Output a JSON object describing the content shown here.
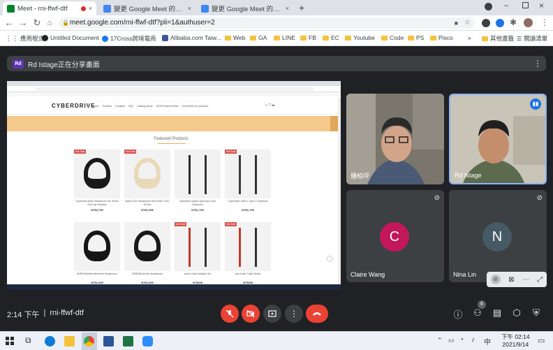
{
  "browser": {
    "tabs": [
      {
        "label": "Meet - rni-ffwf-dtf",
        "close": "×"
      },
      {
        "label": "變更 Google Meet 的背景並使用",
        "close": "×"
      },
      {
        "label": "變更 Google Meet 的背景並使用",
        "close": "×"
      }
    ],
    "new_tab": "+",
    "url": "meet.google.com/rni-ffwf-dtf?pli=1&authuser=2",
    "bookmarks": [
      "應用程式",
      "Untitled Document",
      "17Cross跨境電商",
      "Alibaba.com Taiw...",
      "Web",
      "GA",
      "LINE",
      "FB",
      "EC",
      "Youtube",
      "Code",
      "PS",
      "Pisco",
      "»",
      "其他書籤",
      "閱讀清單"
    ]
  },
  "meet": {
    "presenter_banner": "Rd Istage正在分享畫面",
    "presenter_initials": "Rd",
    "shared_site": {
      "brand": "CYBERDRIVE",
      "nav": [
        "Home",
        "Products",
        "Contacts",
        "FAQ",
        "Catalog ebook",
        "OEM Product Series",
        "Good Word for products"
      ],
      "section_title": "Featured Products",
      "products": [
        {
          "name": "Cyberdrive Bass Headphone M1 Series Ear-Cup Headset",
          "price": "NT$2,799",
          "badge": "Hot Sale"
        },
        {
          "name": "Super DSX Headphone with USB-C DAC Hi-Res",
          "price": "NT$2,999",
          "badge": "Hot Sale"
        },
        {
          "name": "Cyberdrive Apple Lightning In-Ear Earphone",
          "price": "NT$1,799",
          "badge": ""
        },
        {
          "name": "Cyberdrive USB-C Type-C Earphone",
          "price": "NT$1,799",
          "badge": "Hot Sale"
        },
        {
          "name": "M255 Wireless Bluetooth Headphone",
          "price": "NT$2,999",
          "badge": ""
        },
        {
          "name": "M255 Bluetooth Headphone",
          "price": "NT$2,999",
          "badge": ""
        },
        {
          "name": "Audio Cable Adapter Set",
          "price": "NT$399",
          "badge": "Hot Sale"
        },
        {
          "name": "Aux Audio Cable Series",
          "price": "NT$399",
          "badge": "Hot Sale"
        }
      ]
    },
    "participants": [
      {
        "name": "鍾柏坪",
        "type": "video"
      },
      {
        "name": "Rd Istage",
        "type": "video"
      },
      {
        "name": "Claire Wang",
        "initial": "C",
        "color": "#c2185b"
      },
      {
        "name": "Nina Lin",
        "initial": "N",
        "color": "#455a64"
      }
    ],
    "time": "2:14 下午",
    "separator": "|",
    "meeting_code": "rni-ffwf-dtf",
    "participant_count": "6"
  },
  "taskbar": {
    "time": "下午 02:14",
    "date": "2021/9/14",
    "ime": "中"
  },
  "colors": {
    "end_call": "#ea4335",
    "mic_off": "#ea4335",
    "chrome_bg": "#dee1e6",
    "meet_bg": "#202124"
  }
}
